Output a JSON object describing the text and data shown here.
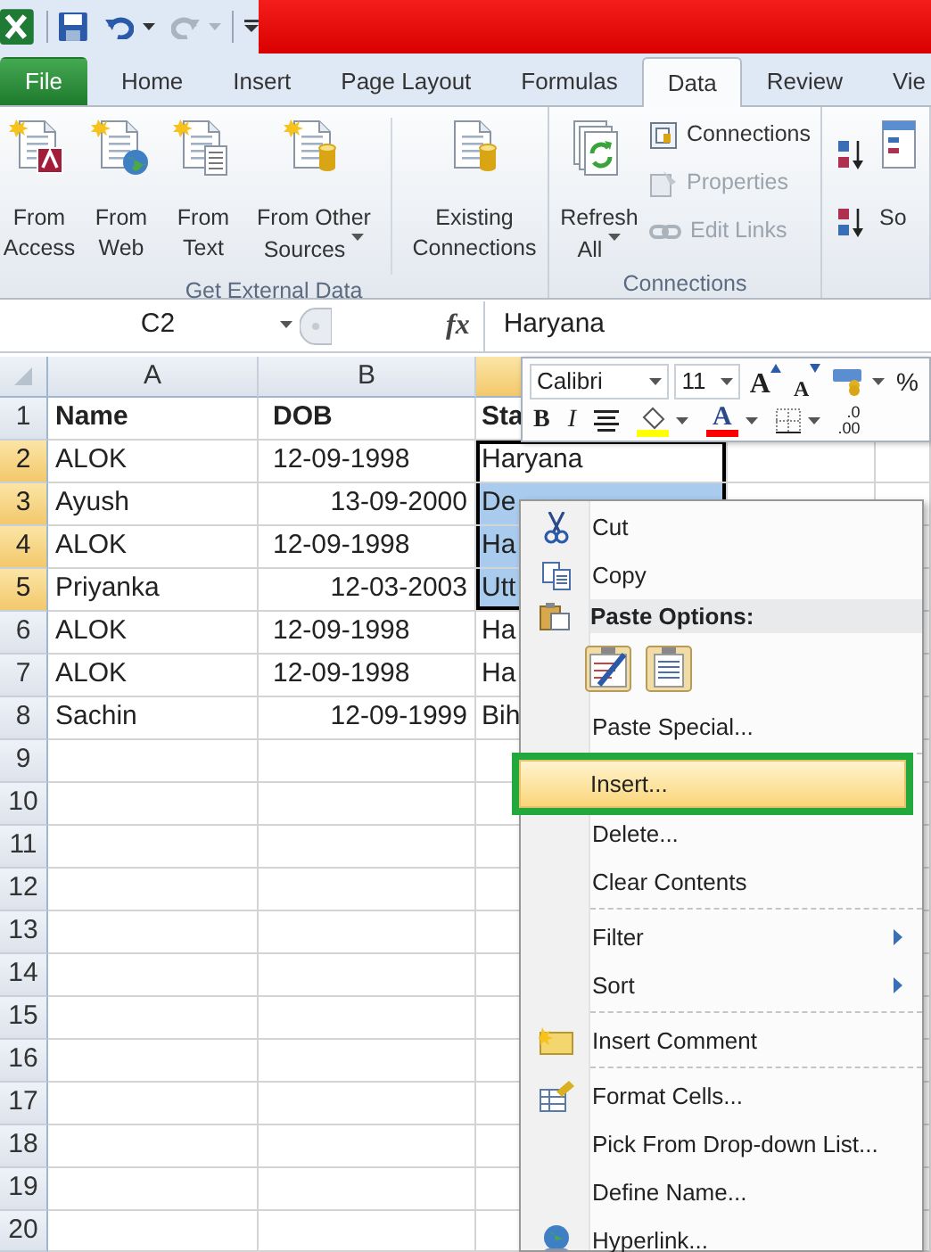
{
  "tabs": [
    {
      "label": "File",
      "kind": "file",
      "selected": false
    },
    {
      "label": "Home",
      "kind": "tab",
      "selected": false
    },
    {
      "label": "Insert",
      "kind": "tab",
      "selected": false
    },
    {
      "label": "Page Layout",
      "kind": "tab",
      "selected": false
    },
    {
      "label": "Formulas",
      "kind": "tab",
      "selected": false
    },
    {
      "label": "Data",
      "kind": "tab",
      "selected": true
    },
    {
      "label": "Review",
      "kind": "tab",
      "selected": false
    },
    {
      "label": "Vie",
      "kind": "tab",
      "selected": false
    }
  ],
  "ribbon": {
    "groups": [
      {
        "label": "Get External Data",
        "buttons": [
          {
            "kind": "access",
            "label": "From Access",
            "dropdown": false
          },
          {
            "kind": "web",
            "label": "From Web",
            "dropdown": false
          },
          {
            "kind": "text",
            "label": "From Text",
            "dropdown": false
          },
          {
            "kind": "other_sources",
            "label": "From Other Sources",
            "dropdown": true
          },
          {
            "kind": "existing",
            "label": "Existing Connections",
            "dropdown": false,
            "separator_before": true
          }
        ]
      },
      {
        "label": "Connections",
        "buttons": [
          {
            "kind": "refresh",
            "label": "Refresh All",
            "dropdown": true
          }
        ],
        "small_buttons": [
          {
            "kind": "connections",
            "label": "Connections",
            "disabled": false
          },
          {
            "kind": "properties",
            "label": "Properties",
            "disabled": true
          },
          {
            "kind": "edit_links",
            "label": "Edit Links",
            "disabled": true
          }
        ]
      },
      {
        "buttons": [
          {
            "kind": "sort_ascending"
          },
          {
            "kind": "sort_descending"
          },
          {
            "kind": "sort",
            "label": "So"
          }
        ]
      }
    ]
  },
  "formula_bar": {
    "name_box": "C2",
    "function_label": "fx",
    "value": "Haryana"
  },
  "sheet": {
    "columns": [
      {
        "label": "A",
        "selected": false
      },
      {
        "label": "B",
        "selected": false
      },
      {
        "selected": true
      }
    ],
    "rows": [
      {
        "label": "1",
        "selected": false,
        "bold": true,
        "cells": [
          {
            "text": "Name"
          },
          {
            "text": "DOB",
            "right_aligned": false
          },
          {
            "text": "Sta"
          }
        ]
      },
      {
        "label": "2",
        "selected": true,
        "cells": [
          {
            "text": "ALOK"
          },
          {
            "text": "12-09-1998",
            "right_aligned": false
          },
          {
            "text": "Haryana",
            "active": true,
            "in_selection": true
          }
        ]
      },
      {
        "label": "3",
        "selected": true,
        "cells": [
          {
            "text": "Ayush"
          },
          {
            "text": "13-09-2000",
            "right_aligned": true
          },
          {
            "text": "De",
            "active": false,
            "in_selection": true
          }
        ]
      },
      {
        "label": "4",
        "selected": true,
        "cells": [
          {
            "text": "ALOK"
          },
          {
            "text": "12-09-1998",
            "right_aligned": false
          },
          {
            "text": "Ha",
            "active": false,
            "in_selection": true
          }
        ]
      },
      {
        "label": "5",
        "selected": true,
        "cells": [
          {
            "text": "Priyanka"
          },
          {
            "text": "12-03-2003",
            "right_aligned": true
          },
          {
            "text": "Utt",
            "active": false,
            "in_selection": true
          }
        ]
      },
      {
        "label": "6",
        "selected": false,
        "cells": [
          {
            "text": "ALOK"
          },
          {
            "text": "12-09-1998",
            "right_aligned": false
          },
          {
            "text": "Ha"
          }
        ]
      },
      {
        "label": "7",
        "selected": false,
        "cells": [
          {
            "text": "ALOK"
          },
          {
            "text": "12-09-1998",
            "right_aligned": false
          },
          {
            "text": "Ha"
          }
        ]
      },
      {
        "label": "8",
        "selected": false,
        "cells": [
          {
            "text": "Sachin"
          },
          {
            "text": "12-09-1999",
            "right_aligned": true
          },
          {
            "text": "Bih"
          }
        ]
      },
      {
        "label": "9",
        "selected": false
      },
      {
        "label": "10",
        "selected": false
      },
      {
        "label": "11",
        "selected": false
      },
      {
        "label": "12",
        "selected": false
      },
      {
        "label": "13",
        "selected": false
      },
      {
        "label": "14",
        "selected": false
      },
      {
        "label": "15",
        "selected": false
      },
      {
        "label": "16",
        "selected": false
      },
      {
        "label": "17",
        "selected": false
      },
      {
        "label": "18",
        "selected": false
      },
      {
        "label": "19",
        "selected": false
      },
      {
        "label": "20",
        "selected": false
      }
    ]
  },
  "mini_toolbar": {
    "font": "Calibri",
    "size": "11",
    "row_1": [
      {
        "kind": "grow_font",
        "label": "A"
      },
      {
        "kind": "shrink_font",
        "label": "A"
      },
      {
        "kind": "accounting"
      },
      {
        "kind": "percent",
        "label": "%"
      }
    ],
    "row_2": [
      {
        "kind": "bold",
        "label": "B"
      },
      {
        "kind": "italic",
        "label": "I"
      },
      {
        "kind": "center"
      },
      {
        "kind": "fill_color",
        "color": "#ffff00"
      },
      {
        "kind": "font_color",
        "label": "A",
        "color": "#ff0000"
      },
      {
        "kind": "borders"
      },
      {
        "kind": "increase_decimal",
        "label": ".0",
        "label_2": ".00"
      }
    ]
  },
  "context_menu": {
    "items": [
      {
        "kind": "cut",
        "label": "Cut",
        "selected": false
      },
      {
        "kind": "copy",
        "label": "Copy",
        "selected": false
      },
      {
        "kind": "header",
        "label": "Paste Options:"
      },
      {
        "kind": "paste_icons"
      },
      {
        "kind": "item",
        "label": "Paste Special...",
        "selected": false
      },
      {
        "kind": "separator"
      },
      {
        "kind": "item",
        "label": "Insert...",
        "selected": true,
        "outlined": true
      },
      {
        "kind": "item",
        "label": "Delete...",
        "selected": false
      },
      {
        "kind": "item",
        "label": "Clear Contents",
        "selected": false
      },
      {
        "kind": "separator"
      },
      {
        "kind": "item",
        "label": "Filter",
        "selected": false,
        "submenu": true
      },
      {
        "kind": "item",
        "label": "Sort",
        "selected": false,
        "submenu": true
      },
      {
        "kind": "separator"
      },
      {
        "kind": "comment",
        "label": "Insert Comment",
        "selected": false
      },
      {
        "kind": "separator"
      },
      {
        "kind": "format",
        "label": "Format Cells...",
        "selected": false
      },
      {
        "kind": "item",
        "label": "Pick From Drop-down List...",
        "selected": false
      },
      {
        "kind": "item",
        "label": "Define Name...",
        "selected": false
      },
      {
        "kind": "hyperlink",
        "label": "Hyperlink...",
        "selected": false
      }
    ]
  }
}
